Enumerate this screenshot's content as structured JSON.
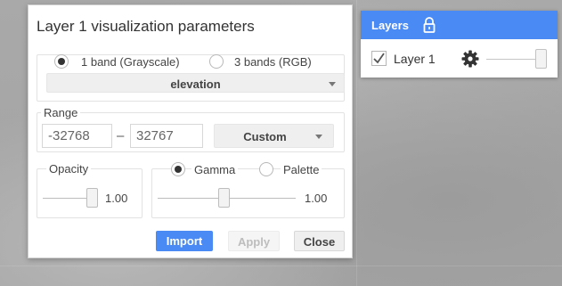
{
  "viz": {
    "title": "Layer 1 visualization parameters",
    "band_options": [
      {
        "label": "1 band (Grayscale)",
        "selected": true
      },
      {
        "label": "3 bands (RGB)",
        "selected": false
      }
    ],
    "band_select": "elevation",
    "range": {
      "legend": "Range",
      "min": "-32768",
      "separator": "–",
      "max": "32767",
      "mode": "Custom"
    },
    "opacity": {
      "legend": "Opacity",
      "value": "1.00",
      "level": 1.0
    },
    "palette_options": [
      {
        "label": "Gamma",
        "selected": true
      },
      {
        "label": "Palette",
        "selected": false
      }
    ],
    "gamma": {
      "value": "1.00"
    },
    "buttons": {
      "import": "Import",
      "apply": "Apply",
      "close": "Close"
    }
  },
  "layers": {
    "title": "Layers",
    "items": [
      {
        "name": "Layer 1",
        "checked": true,
        "opacity": 1.0
      }
    ]
  },
  "colors": {
    "accent": "#4a8af4",
    "map_bg": "#a6a6a6"
  },
  "icons": [
    "lock-icon",
    "gear-icon",
    "chevron-down-icon",
    "checkmark-icon"
  ]
}
